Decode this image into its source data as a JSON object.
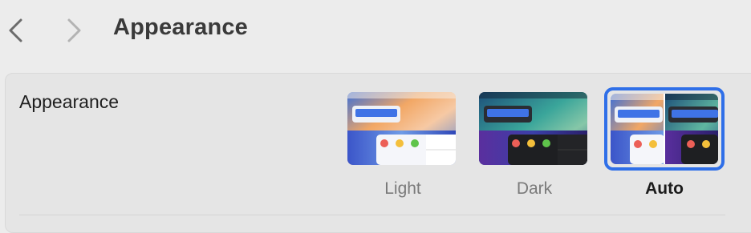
{
  "toolbar": {
    "title": "Appearance",
    "back_icon": "chevron-left-icon",
    "forward_icon": "chevron-right-icon"
  },
  "appearance_row": {
    "label": "Appearance",
    "options": [
      {
        "label": "Light",
        "selected": false
      },
      {
        "label": "Dark",
        "selected": false
      },
      {
        "label": "Auto",
        "selected": true
      }
    ]
  },
  "colors": {
    "accent": "#2f6fe8",
    "traffic_red": "#ec5f57",
    "traffic_yellow": "#f4bf3b",
    "traffic_green": "#5fc44b"
  }
}
